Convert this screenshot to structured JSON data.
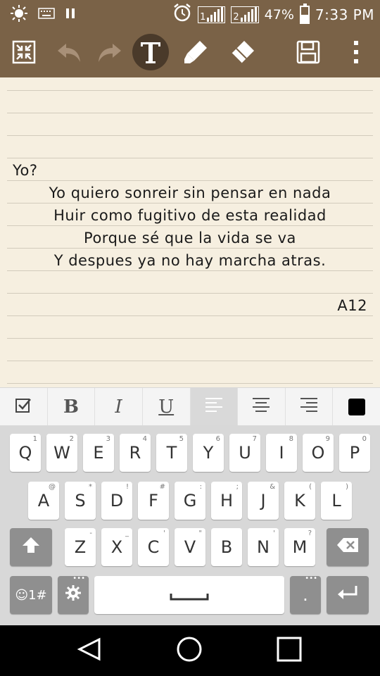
{
  "status_bar": {
    "battery_percent": "47%",
    "time": "7:33 PM",
    "sim1_label": "1",
    "sim2_label": "2",
    "battery_level": 0.47,
    "icons": [
      "brightness-icon",
      "keyboard-icon",
      "pause-icon",
      "alarm-icon",
      "signal-sim1-icon",
      "signal-sim2-icon",
      "battery-icon"
    ]
  },
  "toolbar": {
    "icons": [
      "collapse-icon",
      "undo-icon",
      "redo-icon",
      "text-tool-icon",
      "highlighter-icon",
      "eraser-icon",
      "save-icon",
      "more-vert-icon"
    ],
    "active_tool": "text"
  },
  "note": {
    "lines": [
      "Yo?",
      "Yo quiero sonreir sin pensar en nada",
      "Huir como fugitivo de esta realidad",
      "Porque sé que la vida se va",
      "Y despues ya no hay marcha atras.",
      "A12"
    ]
  },
  "format_bar": {
    "bold_label": "B",
    "italic_label": "I",
    "underline_label": "U",
    "active_alignment": "left",
    "color": "#000000"
  },
  "keyboard": {
    "row1": [
      [
        "Q",
        "1"
      ],
      [
        "W",
        "2"
      ],
      [
        "E",
        "3"
      ],
      [
        "R",
        "4"
      ],
      [
        "T",
        "5"
      ],
      [
        "Y",
        "6"
      ],
      [
        "U",
        "7"
      ],
      [
        "I",
        "8"
      ],
      [
        "O",
        "9"
      ],
      [
        "P",
        "0"
      ]
    ],
    "row2": [
      [
        "A",
        "@"
      ],
      [
        "S",
        "*"
      ],
      [
        "D",
        "!"
      ],
      [
        "F",
        "#"
      ],
      [
        "G",
        ":"
      ],
      [
        "H",
        ";"
      ],
      [
        "J",
        "&"
      ],
      [
        "K",
        "("
      ],
      [
        "L",
        ")"
      ]
    ],
    "row3": [
      [
        "Z",
        "-"
      ],
      [
        "X",
        "_"
      ],
      [
        "C",
        "'"
      ],
      [
        "V",
        "\""
      ],
      [
        "B",
        ""
      ],
      [
        "N",
        "'"
      ],
      [
        "M",
        "?"
      ]
    ],
    "symbols_label": "☺1#",
    "period_label": "."
  }
}
